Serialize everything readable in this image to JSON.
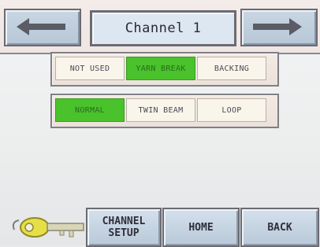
{
  "header": {
    "title": "Channel 1",
    "prev_icon": "left-arrow-icon",
    "next_icon": "right-arrow-icon"
  },
  "sensor_type": {
    "options": [
      "NOT USED",
      "YARN BREAK",
      "BACKING"
    ],
    "selected": "YARN BREAK"
  },
  "mode": {
    "options": [
      "NORMAL",
      "TWIN BEAM",
      "LOOP"
    ],
    "selected": "NORMAL"
  },
  "footer": {
    "key_icon": "key-icon",
    "channel_setup_label": "CHANNEL\nSETUP",
    "home_label": "HOME",
    "back_label": "BACK"
  },
  "colors": {
    "selected": "#49c22b",
    "button": "#c9d6e3",
    "option": "#f9f5ea"
  }
}
